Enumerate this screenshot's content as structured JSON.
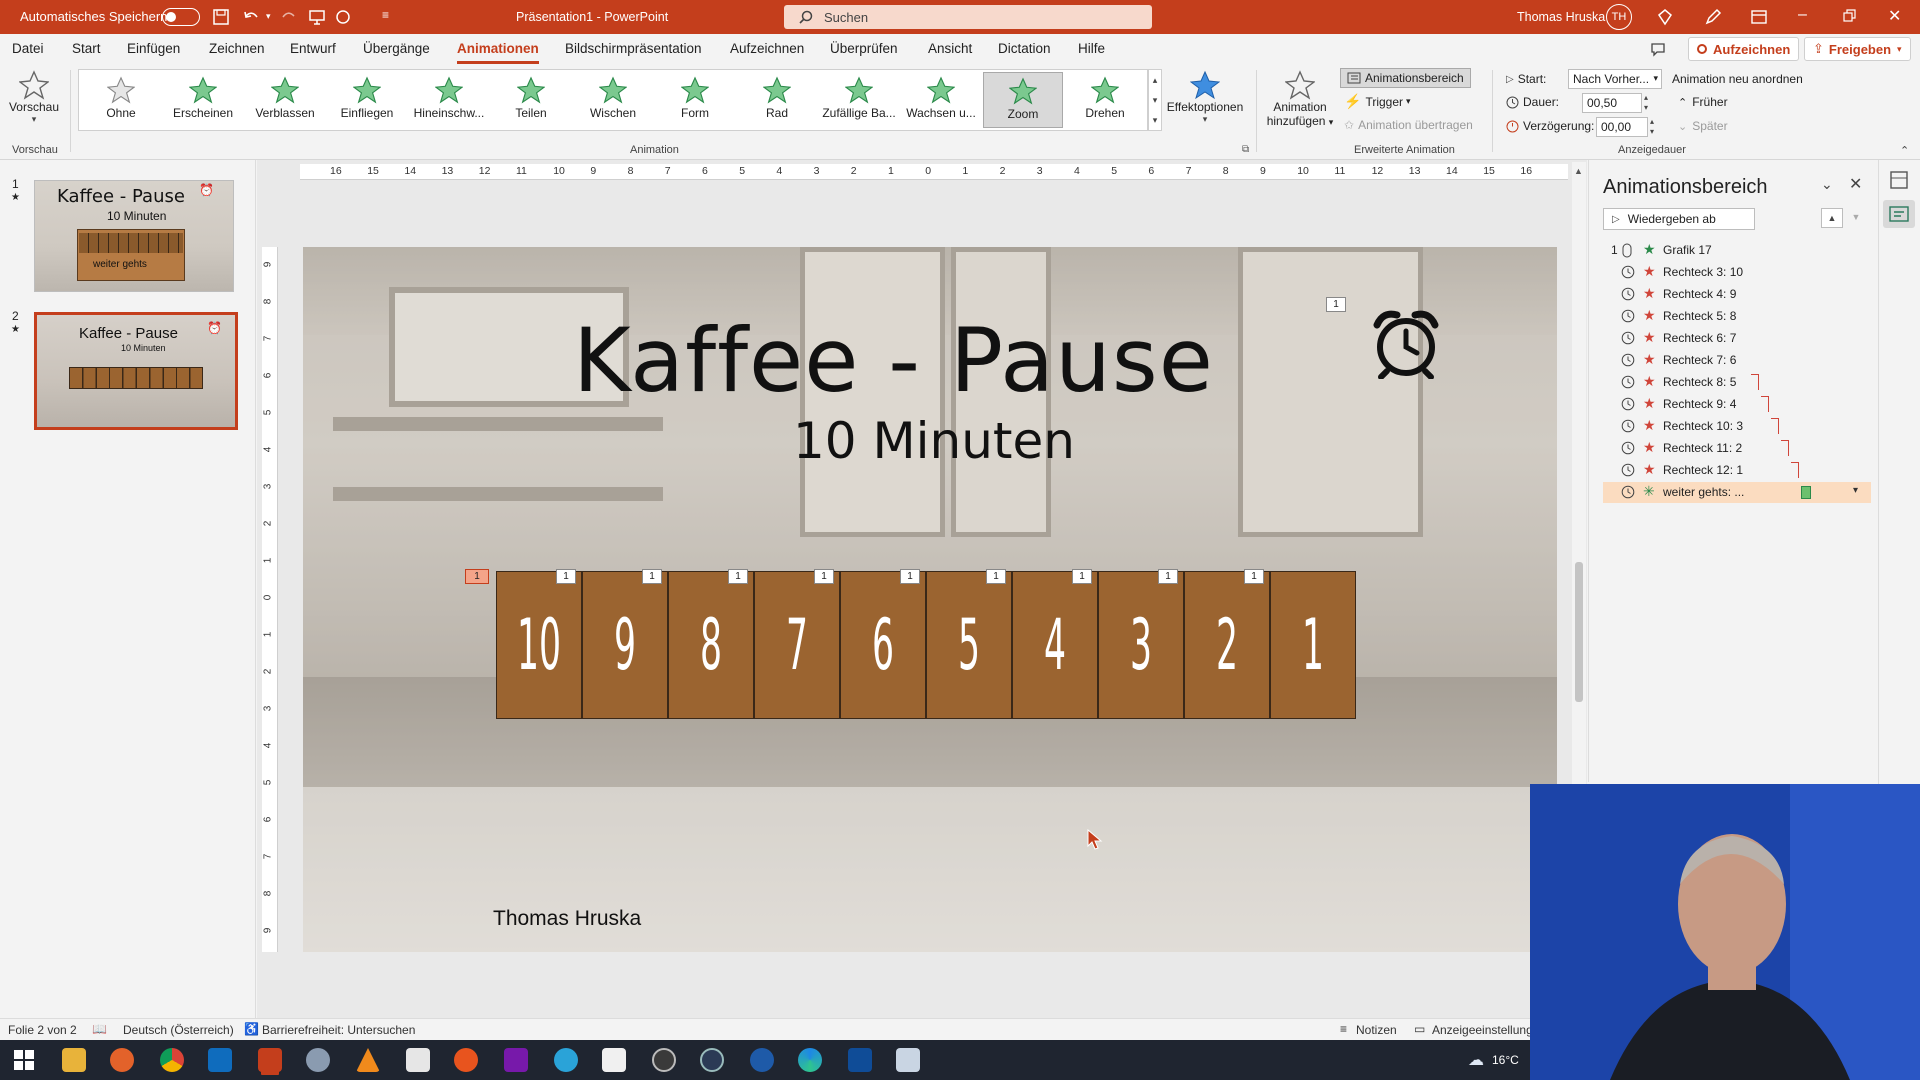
{
  "titlebar": {
    "autosave_label": "Automatisches Speichern",
    "doc_title": "Präsentation1 - PowerPoint",
    "search_placeholder": "Suchen",
    "user_name": "Thomas Hruska",
    "user_initials": "TH"
  },
  "menu": {
    "items": [
      "Datei",
      "Start",
      "Einfügen",
      "Zeichnen",
      "Entwurf",
      "Übergänge",
      "Animationen",
      "Bildschirmpräsentation",
      "Aufzeichnen",
      "Überprüfen",
      "Ansicht",
      "Dictation",
      "Hilfe"
    ],
    "active": "Animationen",
    "record_label": "Aufzeichnen",
    "share_label": "Freigeben"
  },
  "ribbon": {
    "preview_label": "Vorschau",
    "preview_group": "Vorschau",
    "animation_group": "Animation",
    "effects": [
      "Ohne",
      "Erscheinen",
      "Verblassen",
      "Einfliegen",
      "Hineinschw...",
      "Teilen",
      "Wischen",
      "Form",
      "Rad",
      "Zufällige Ba...",
      "Wachsen u...",
      "Zoom",
      "Drehen"
    ],
    "selected_effect": "Zoom",
    "effect_options_label": "Effektoptionen",
    "add_animation_label1": "Animation",
    "add_animation_label2": "hinzufügen",
    "anim_pane_btn": "Animationsbereich",
    "trigger_label": "Trigger",
    "copy_anim_label": "Animation übertragen",
    "advanced_group": "Erweiterte Animation",
    "start_label": "Start:",
    "start_value": "Nach Vorher...",
    "duration_label": "Dauer:",
    "duration_value": "00,50",
    "delay_label": "Verzögerung:",
    "delay_value": "00,00",
    "reorder_label": "Animation neu anordnen",
    "earlier_label": "Früher",
    "later_label": "Später",
    "timing_group": "Anzeigedauer"
  },
  "slides_panel": {
    "thumbs": [
      {
        "num": "1",
        "title": "Kaffee - Pause",
        "subtitle": "10 Minuten",
        "footer": "weiter gehts"
      },
      {
        "num": "2",
        "title": "Kaffee - Pause",
        "subtitle": "10 Minuten"
      }
    ]
  },
  "slide": {
    "title": "Kaffee - Pause",
    "subtitle": "10 Minuten",
    "author": "Thomas Hruska",
    "countdown": [
      "10",
      "9",
      "8",
      "7",
      "6",
      "5",
      "4",
      "3",
      "2",
      "1"
    ],
    "anim_tag": "1",
    "clock_tag": "1",
    "colors": {
      "box": "#9b6430",
      "box_border": "#3a2818",
      "tag": "#f4a489"
    }
  },
  "ruler": {
    "h_labels": [
      "16",
      "15",
      "14",
      "13",
      "12",
      "11",
      "10",
      "9",
      "8",
      "7",
      "6",
      "5",
      "4",
      "3",
      "2",
      "1",
      "0",
      "1",
      "2",
      "3",
      "4",
      "5",
      "6",
      "7",
      "8",
      "9",
      "10",
      "11",
      "12",
      "13",
      "14",
      "15",
      "16"
    ],
    "v_labels": [
      "9",
      "8",
      "7",
      "6",
      "5",
      "4",
      "3",
      "2",
      "1",
      "0",
      "1",
      "2",
      "3",
      "4",
      "5",
      "6",
      "7",
      "8",
      "9"
    ]
  },
  "anim_pane": {
    "title": "Animationsbereich",
    "play_label": "Wiedergeben ab",
    "group_num": "1",
    "items": [
      "Grafik 17",
      "Rechteck 3: 10",
      "Rechteck 4: 9",
      "Rechteck 5: 8",
      "Rechteck 6: 7",
      "Rechteck 7: 6",
      "Rechteck 8: 5",
      "Rechteck 9: 4",
      "Rechteck 10: 3",
      "Rechteck 11: 2",
      "Rechteck 12: 1",
      "weiter gehts: ..."
    ]
  },
  "status": {
    "slide_info": "Folie 2 von 2",
    "language": "Deutsch (Österreich)",
    "accessibility": "Barrierefreiheit: Untersuchen",
    "notes": "Notizen",
    "display": "Anzeigeeinstellung"
  },
  "taskbar": {
    "temperature": "16°C"
  }
}
